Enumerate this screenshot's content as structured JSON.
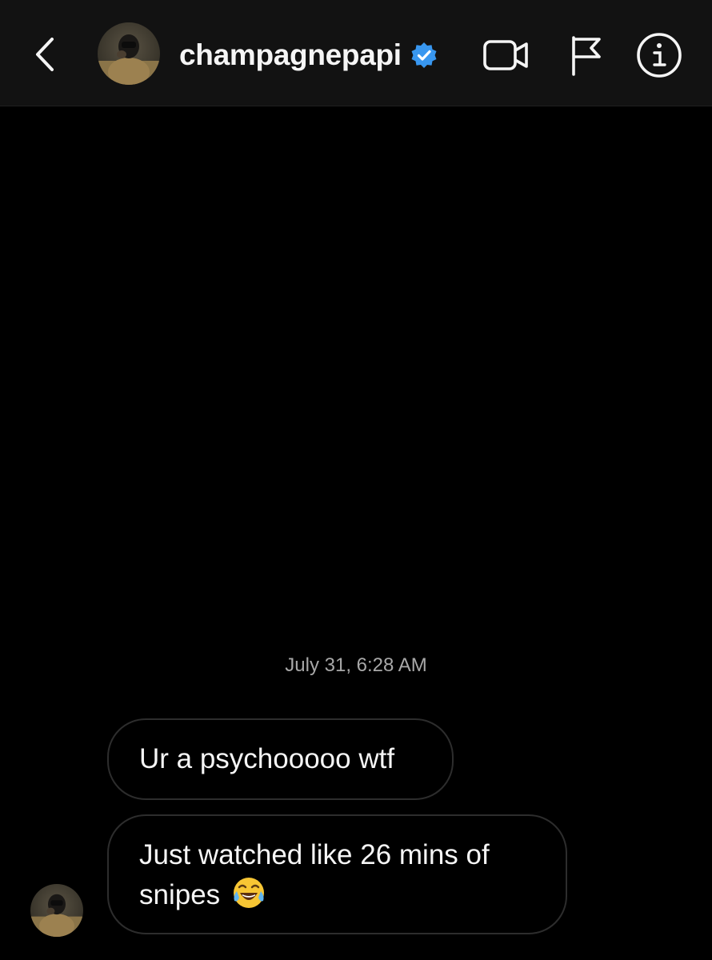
{
  "header": {
    "username": "champagnepapi",
    "verified": true,
    "icons": {
      "back": "chevron-left-icon",
      "verified": "verified-badge-icon",
      "video": "video-camera-icon",
      "report": "flag-icon",
      "info": "info-icon"
    }
  },
  "thread": {
    "timestamp": "July 31, 6:28 AM",
    "messages": [
      {
        "text": "Ur a psychooooo wtf"
      },
      {
        "line1": "Just watched like 26 mins of",
        "line2": "snipes",
        "emoji": "face-with-tears-of-joy-emoji"
      }
    ]
  },
  "colors": {
    "background": "#000000",
    "header_bg": "#121212",
    "bubble_border": "#2d2d2d",
    "timestamp": "#a8a8a8",
    "verified_blue": "#3897f0"
  }
}
